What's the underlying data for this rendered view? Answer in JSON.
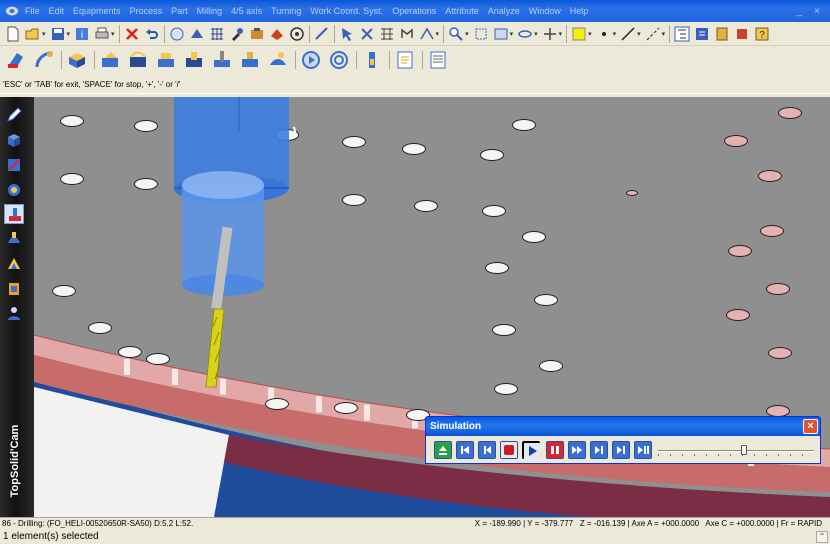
{
  "menubar": {
    "items": [
      "File",
      "Edit",
      "Equipments",
      "Process",
      "Part",
      "Milling",
      "4/5 axis",
      "Turning",
      "Work Coord. Syst.",
      "Operations",
      "Attribute",
      "Analyze",
      "Window",
      "Help"
    ],
    "window_controls": [
      "_",
      "×"
    ]
  },
  "prompt": {
    "text": "'ESC' or 'TAB' for exit, 'SPACE' for stop, '+', '-' or '/'"
  },
  "leftbar": {
    "brand": "TopSolid'Cam"
  },
  "simulation": {
    "title": "Simulation",
    "close_label": "×",
    "slider_position": 0.55
  },
  "status": {
    "operation": "86 - Drilling:    (FO_HELI-00520650R-SA50) D:5.2  L:52.",
    "x": "X = -189.990",
    "y": "Y = -379.777",
    "z": "Z = -016.139",
    "axe_a": "Axe A = +000.0000",
    "axe_c": "Axe C = +000.0000",
    "fr": "Fr = RAPID",
    "selection": "1 element(s) selected"
  },
  "colors": {
    "title_blue": "#0a58d8",
    "plate_gray": "#8f8f8f",
    "rim_pink": "#d48888",
    "rim_red": "#7a2d45",
    "part_blue": "#1f4d9c",
    "tool_blue": "#3d7de0",
    "drill_yellow": "#d9d21a"
  }
}
